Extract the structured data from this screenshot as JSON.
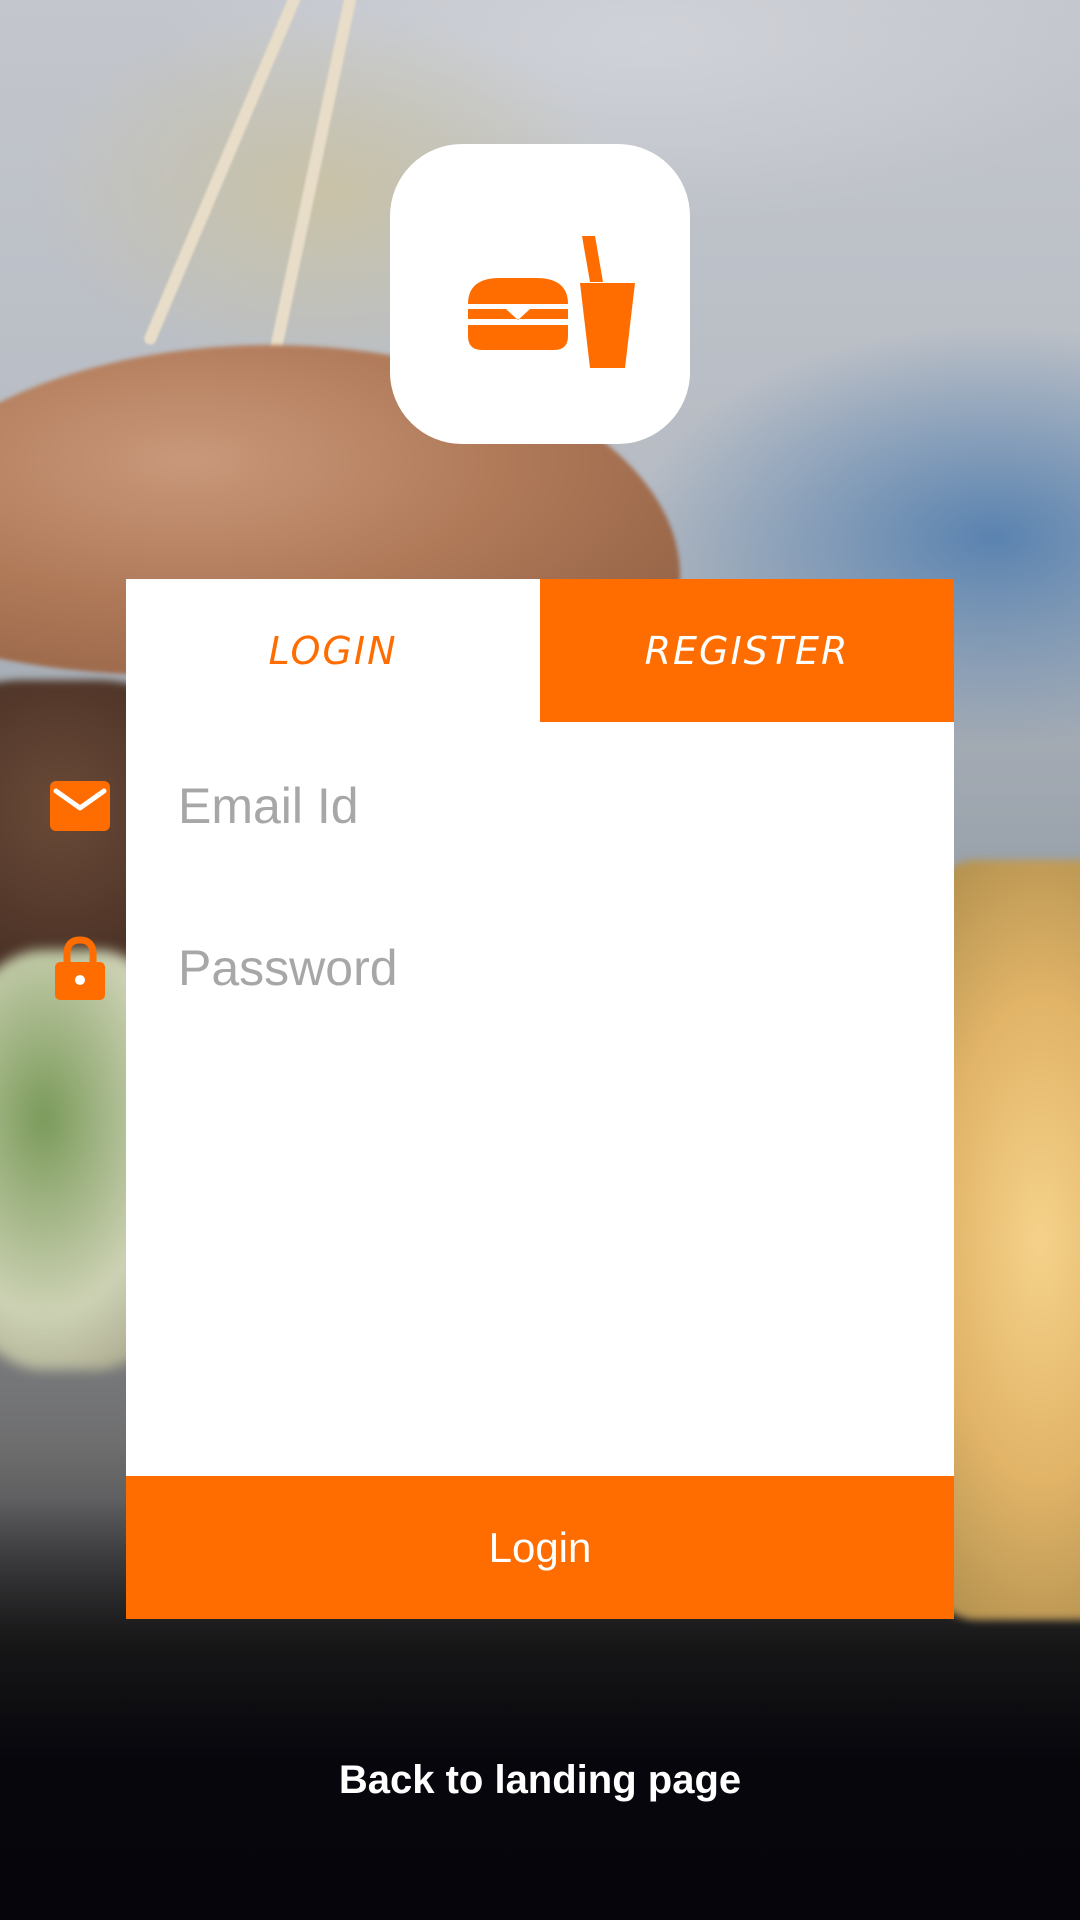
{
  "colors": {
    "accent": "#ff6d00",
    "card": "#ffffff",
    "placeholder": "#a7a7a7"
  },
  "logo": {
    "icon": "burger-and-drink-icon"
  },
  "tabs": [
    {
      "label": "LOGIN",
      "active": true
    },
    {
      "label": "REGISTER",
      "active": false
    }
  ],
  "form": {
    "email": {
      "icon": "envelope-icon",
      "placeholder": "Email Id",
      "value": ""
    },
    "password": {
      "icon": "lock-icon",
      "placeholder": "Password",
      "value": ""
    }
  },
  "login_button": {
    "label": "Login"
  },
  "back_link": {
    "label": "Back to landing page"
  }
}
